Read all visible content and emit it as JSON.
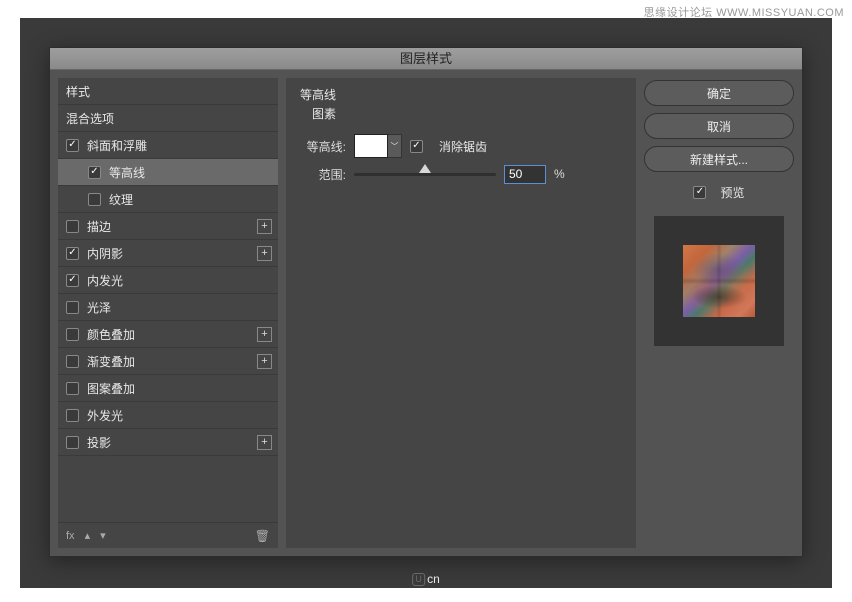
{
  "watermark": "思缘设计论坛  WWW.MISSYUAN.COM",
  "dialog": {
    "title": "图层样式"
  },
  "left": {
    "styles_header": "样式",
    "blend_header": "混合选项",
    "items": [
      {
        "label": "斜面和浮雕",
        "checked": true,
        "sub": false,
        "plus": false,
        "sel": false
      },
      {
        "label": "等高线",
        "checked": true,
        "sub": true,
        "plus": false,
        "sel": true
      },
      {
        "label": "纹理",
        "checked": false,
        "sub": true,
        "plus": false,
        "sel": false
      },
      {
        "label": "描边",
        "checked": false,
        "sub": false,
        "plus": true,
        "sel": false
      },
      {
        "label": "内阴影",
        "checked": true,
        "sub": false,
        "plus": true,
        "sel": false
      },
      {
        "label": "内发光",
        "checked": true,
        "sub": false,
        "plus": false,
        "sel": false
      },
      {
        "label": "光泽",
        "checked": false,
        "sub": false,
        "plus": false,
        "sel": false
      },
      {
        "label": "颜色叠加",
        "checked": false,
        "sub": false,
        "plus": true,
        "sel": false
      },
      {
        "label": "渐变叠加",
        "checked": false,
        "sub": false,
        "plus": true,
        "sel": false
      },
      {
        "label": "图案叠加",
        "checked": false,
        "sub": false,
        "plus": false,
        "sel": false
      },
      {
        "label": "外发光",
        "checked": false,
        "sub": false,
        "plus": false,
        "sel": false
      },
      {
        "label": "投影",
        "checked": false,
        "sub": false,
        "plus": true,
        "sel": false
      }
    ],
    "fx": "fx"
  },
  "mid": {
    "group_title": "等高线",
    "group_sub": "图素",
    "contour_label": "等高线:",
    "anti_label": "消除锯齿",
    "anti_checked": true,
    "range_label": "范围:",
    "range_value": "50",
    "pct": "%"
  },
  "right": {
    "ok": "确定",
    "cancel": "取消",
    "newstyle": "新建样式...",
    "preview_label": "预览",
    "preview_checked": true
  },
  "footer": "cn"
}
